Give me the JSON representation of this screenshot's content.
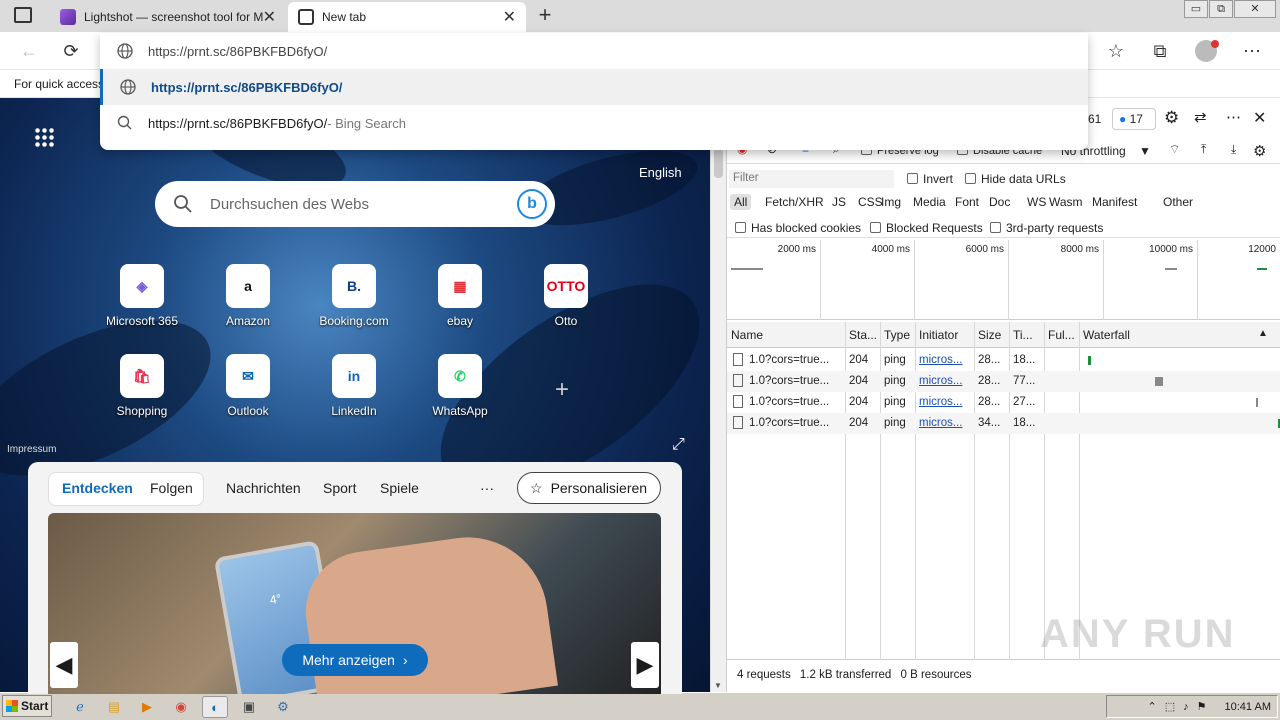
{
  "tabs": [
    {
      "title": "Lightshot — screenshot tool for Ma",
      "close": "✕"
    },
    {
      "title": "New tab",
      "close": "✕"
    }
  ],
  "new_tab_button": "+",
  "window_controls": [
    "▭",
    "⧉",
    "✕"
  ],
  "omnibox": {
    "input_value": "https://prnt.sc/86PBKFBD6fyO/",
    "suggestions": [
      {
        "text": "https://prnt.sc/86PBKFBD6fyO/",
        "suffix": ""
      },
      {
        "text": "https://prnt.sc/86PBKFBD6fyO/",
        "suffix": " - Bing Search"
      }
    ]
  },
  "favbar": {
    "text": "For quick access"
  },
  "ntp": {
    "language": "English",
    "search_placeholder": "Durchsuchen des Webs",
    "impressum": "Impressum",
    "tiles_row1": [
      {
        "label": "Microsoft 365",
        "icon": "◈",
        "color": "#7b5cd6"
      },
      {
        "label": "Amazon",
        "icon": "a",
        "color": "#111111"
      },
      {
        "label": "Booking.com",
        "icon": "B.",
        "color": "#0b3d91"
      },
      {
        "label": "ebay",
        "icon": "▦",
        "color": "#e53238"
      },
      {
        "label": "Otto",
        "icon": "OTTO",
        "color": "#e2001a"
      }
    ],
    "tiles_row2": [
      {
        "label": "Shopping",
        "icon": "🛍",
        "color": "#e8344d"
      },
      {
        "label": "Outlook",
        "icon": "✉",
        "color": "#0a64b4"
      },
      {
        "label": "LinkedIn",
        "icon": "in",
        "color": "#0a66c2"
      },
      {
        "label": "WhatsApp",
        "icon": "✆",
        "color": "#25d366"
      }
    ],
    "add_tile": "+",
    "feed": {
      "tabs": [
        "Entdecken",
        "Folgen",
        "Nachrichten",
        "Sport",
        "Spiele"
      ],
      "more": "···",
      "personalize": "Personalisieren",
      "more_button": "Mehr anzeigen",
      "phone_temp": "4°"
    }
  },
  "devtools": {
    "badge_count": "17",
    "badge_partial": "61",
    "options": {
      "preserve_log": "Preserve log",
      "disable_cache": "Disable cache",
      "throttling": "No throttling"
    },
    "filter_placeholder": "Filter",
    "invert": "Invert",
    "hide_data_urls": "Hide data URLs",
    "type_filters": [
      "All",
      "Fetch/XHR",
      "JS",
      "CSS",
      "Img",
      "Media",
      "Font",
      "Doc",
      "WS",
      "Wasm",
      "Manifest",
      "Other"
    ],
    "checkboxes2": [
      "Has blocked cookies",
      "Blocked Requests",
      "3rd-party requests"
    ],
    "timeline_ticks": [
      "2000 ms",
      "4000 ms",
      "6000 ms",
      "8000 ms",
      "10000 ms",
      "12000"
    ],
    "columns": [
      "Name",
      "Sta...",
      "Type",
      "Initiator",
      "Size",
      "Ti...",
      "Ful...",
      "Waterfall"
    ],
    "rows": [
      {
        "name": "1.0?cors=true...",
        "status": "204",
        "type": "ping",
        "initiator": "micros...",
        "size": "28...",
        "time": "18..."
      },
      {
        "name": "1.0?cors=true...",
        "status": "204",
        "type": "ping",
        "initiator": "micros...",
        "size": "28...",
        "time": "77..."
      },
      {
        "name": "1.0?cors=true...",
        "status": "204",
        "type": "ping",
        "initiator": "micros...",
        "size": "28...",
        "time": "27..."
      },
      {
        "name": "1.0?cors=true...",
        "status": "204",
        "type": "ping",
        "initiator": "micros...",
        "size": "34...",
        "time": "18..."
      }
    ],
    "status_bar": {
      "requests": "4 requests",
      "transferred": "1.2 kB transferred",
      "resources": "0 B resources"
    }
  },
  "taskbar": {
    "start": "Start",
    "time": "10:41 AM"
  },
  "watermark": "ANY RUN"
}
